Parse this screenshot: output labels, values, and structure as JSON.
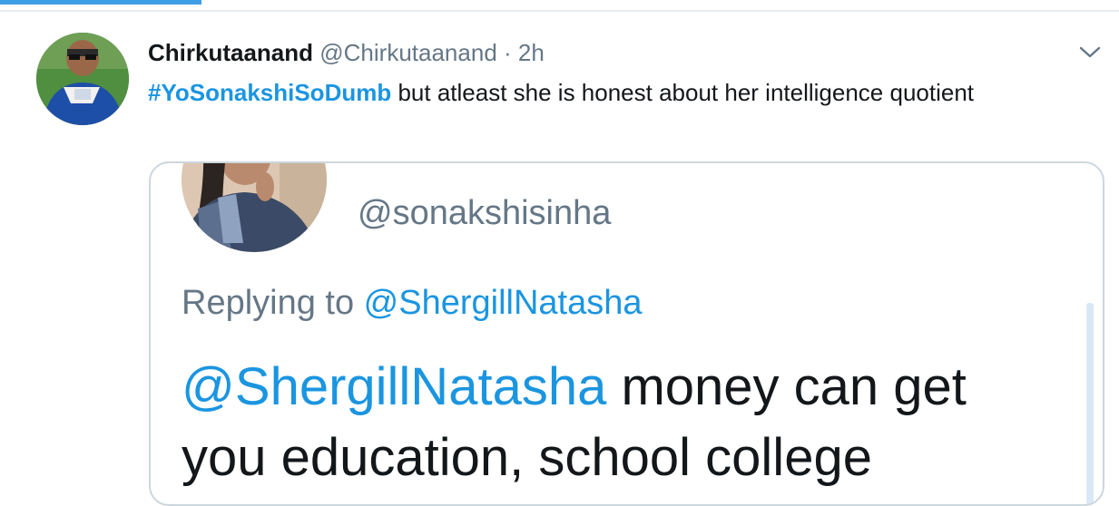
{
  "tweet": {
    "display_name": "Chirkutaanand",
    "handle": "@Chirkutaanand",
    "separator": "·",
    "time": "2h",
    "hashtag": "#YoSonakshiSoDumb",
    "text": " but atleast she is honest about her intelligence quotient",
    "icons": {
      "menu": "chevron-down-icon",
      "avatar": "avatar"
    }
  },
  "quote": {
    "handle": "@sonakshisinha",
    "replying_prefix": "Replying to ",
    "replying_mention": "@ShergillNatasha",
    "mention": "@ShergillNatasha",
    "body": " money can get you education, school college"
  },
  "colors": {
    "accent": "#1b95e0",
    "secondary_text": "#657786",
    "border": "#ccd6dd",
    "tab_indicator": "#3e9ee6"
  }
}
